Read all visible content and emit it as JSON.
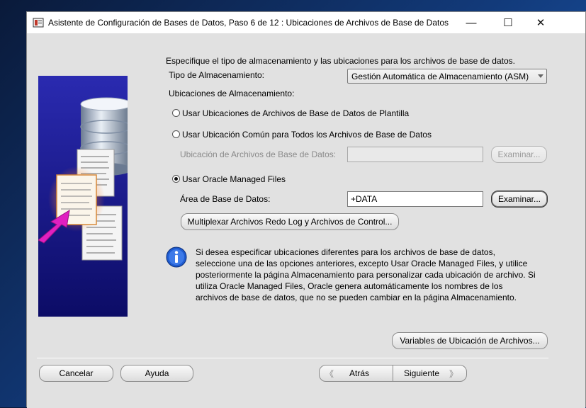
{
  "window": {
    "title": "Asistente de Configuración de Bases de Datos, Paso 6 de 12 : Ubicaciones de Archivos de Base de Datos",
    "minimize_glyph": "—",
    "maximize_glyph": "☐",
    "close_glyph": "✕"
  },
  "main": {
    "intro": "Especifique el tipo de almacenamiento y las ubicaciones para los archivos de base de datos.",
    "storage_type_label": "Tipo de Almacenamiento:",
    "storage_type_value": "Gestión Automática de Almacenamiento (ASM)",
    "locations_label": "Ubicaciones de Almacenamiento:",
    "radio_template": "Usar Ubicaciones de Archivos de Base de Datos de Plantilla",
    "radio_common": "Usar Ubicación Común para Todos los Archivos de Base de Datos",
    "common_location_label": "Ubicación de Archivos de Base de Datos:",
    "common_location_value": "",
    "browse_disabled": "Examinar...",
    "radio_omf": "Usar Oracle Managed Files",
    "db_area_label": "Área de Base de Datos:",
    "db_area_value": "+DATA",
    "browse": "Examinar...",
    "multiplex": "Multiplexar Archivos Redo Log y Archivos de Control...",
    "selected_option": "omf",
    "info_lines": [
      "Si desea especificar ubicaciones diferentes para los archivos de base de datos,",
      "seleccione una de las opciones anteriores, excepto Usar Oracle Managed Files, y utilice",
      "posteriormente la página Almacenamiento para personalizar cada ubicación de archivo. Si",
      "utiliza Oracle Managed Files, Oracle genera automáticamente los nombres de los",
      "archivos de base de datos, que no se pueden cambiar en la página Almacenamiento."
    ],
    "file_location_vars": "Variables de Ubicación de Archivos..."
  },
  "footer": {
    "cancel": "Cancelar",
    "help": "Ayuda",
    "back": "Atrás",
    "next": "Siguiente"
  },
  "colors": {
    "panel_blue": "#1c1c8c",
    "accent_magenta": "#e020c0",
    "info_blue": "#1e5bd0"
  }
}
